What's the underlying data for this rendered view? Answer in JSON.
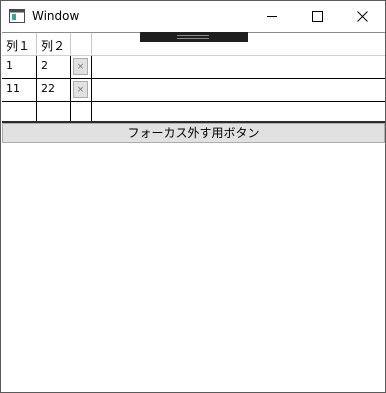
{
  "window": {
    "title": "Window",
    "icon": "app-window-icon",
    "controls": [
      "minimize-icon",
      "maximize-icon",
      "close-icon"
    ]
  },
  "grid": {
    "columns": [
      "列１",
      "列２",
      "",
      ""
    ],
    "rows": [
      {
        "col1": "1",
        "col2": "2",
        "delete_label": "×"
      },
      {
        "col1": "11",
        "col2": "22",
        "delete_label": "×"
      },
      {
        "col1": "",
        "col2": ""
      }
    ]
  },
  "focus_button": {
    "label": "フォーカス外す用ボタン"
  }
}
